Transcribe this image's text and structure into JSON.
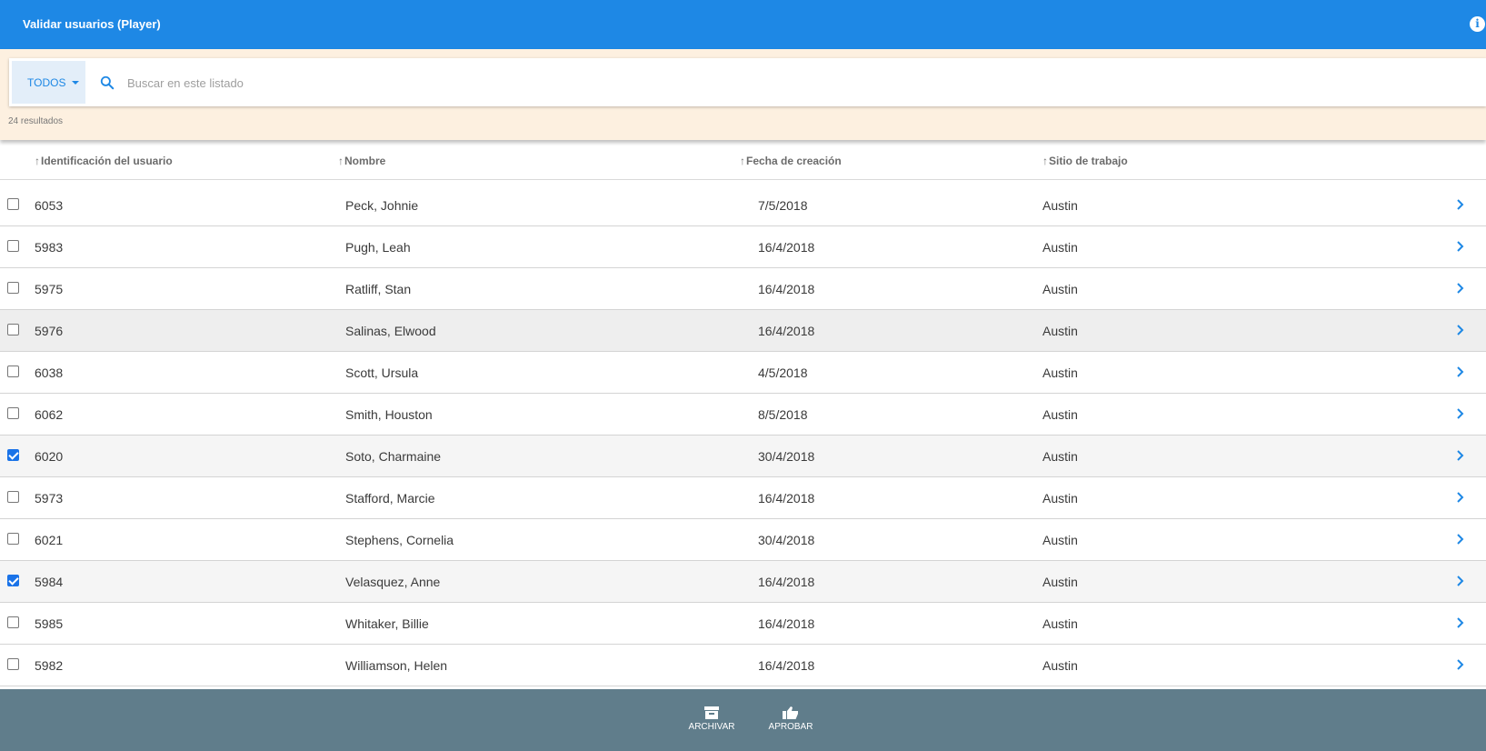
{
  "header": {
    "title": "Validar usuarios (Player)",
    "info_icon": "info-icon"
  },
  "filter": {
    "dropdown_label": "TODOS",
    "search_placeholder": "Buscar en este listado",
    "search_value": "",
    "results_text": "24 resultados"
  },
  "columns": [
    {
      "label": "Identificación del usuario"
    },
    {
      "label": "Nombre"
    },
    {
      "label": "Fecha de creación"
    },
    {
      "label": "Sitio de trabajo"
    }
  ],
  "rows": [
    {
      "id": "6053",
      "name": "Peck, Johnie",
      "date": "7/5/2018",
      "site": "Austin",
      "checked": false,
      "bg": "#ffffff"
    },
    {
      "id": "5983",
      "name": "Pugh, Leah",
      "date": "16/4/2018",
      "site": "Austin",
      "checked": false,
      "bg": "#ffffff"
    },
    {
      "id": "5975",
      "name": "Ratliff, Stan",
      "date": "16/4/2018",
      "site": "Austin",
      "checked": false,
      "bg": "#ffffff"
    },
    {
      "id": "5976",
      "name": "Salinas, Elwood",
      "date": "16/4/2018",
      "site": "Austin",
      "checked": false,
      "bg": "#eeeeee"
    },
    {
      "id": "6038",
      "name": "Scott, Ursula",
      "date": "4/5/2018",
      "site": "Austin",
      "checked": false,
      "bg": "#ffffff"
    },
    {
      "id": "6062",
      "name": "Smith, Houston",
      "date": "8/5/2018",
      "site": "Austin",
      "checked": false,
      "bg": "#ffffff"
    },
    {
      "id": "6020",
      "name": "Soto, Charmaine",
      "date": "30/4/2018",
      "site": "Austin",
      "checked": true,
      "bg": "#f5f5f5"
    },
    {
      "id": "5973",
      "name": "Stafford, Marcie",
      "date": "16/4/2018",
      "site": "Austin",
      "checked": false,
      "bg": "#ffffff"
    },
    {
      "id": "6021",
      "name": "Stephens, Cornelia",
      "date": "30/4/2018",
      "site": "Austin",
      "checked": false,
      "bg": "#ffffff"
    },
    {
      "id": "5984",
      "name": "Velasquez, Anne",
      "date": "16/4/2018",
      "site": "Austin",
      "checked": true,
      "bg": "#f5f5f5"
    },
    {
      "id": "5985",
      "name": "Whitaker, Billie",
      "date": "16/4/2018",
      "site": "Austin",
      "checked": false,
      "bg": "#ffffff"
    },
    {
      "id": "5982",
      "name": "Williamson, Helen",
      "date": "16/4/2018",
      "site": "Austin",
      "checked": false,
      "bg": "#ffffff"
    }
  ],
  "actions": {
    "archive_label": "ARCHIVAR",
    "approve_label": "APROBAR"
  },
  "colors": {
    "appbar": "#1e88e5",
    "filter_band": "#fdf0e0",
    "bottom_bar": "#607d8b",
    "checkbox_checked": "#1a73e8"
  }
}
